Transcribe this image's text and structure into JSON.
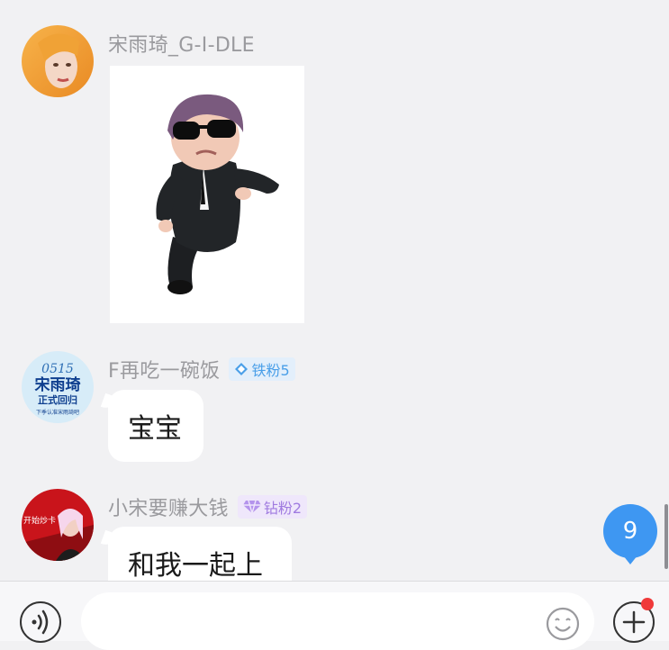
{
  "messages": [
    {
      "name": "宋雨琦_G-I-DLE",
      "type": "sticker",
      "sticker": "black-suit-sunglasses-sticker"
    },
    {
      "name": "F再吃一碗饭",
      "badge": {
        "icon": "diamond-shape-icon",
        "label": "铁粉5"
      },
      "text": "宝宝",
      "avatar_text": {
        "line1": "0515",
        "line2": "宋雨琦",
        "line3": "正式回归",
        "line4": "下季认准宋雨琦吧"
      }
    },
    {
      "name": "小宋要赚大钱",
      "badge": {
        "icon": "gem-icon",
        "label": "钻粉2"
      },
      "text": "和我一起上",
      "avatar_text": {
        "line1": "开始炒卡"
      }
    }
  ],
  "unread_count": "9",
  "input": {
    "placeholder": ""
  },
  "colors": {
    "accent": "#3e97f2",
    "iron_badge": "#4a9fe8",
    "diamond_badge": "#a07be0",
    "notification": "#f03a3a"
  }
}
